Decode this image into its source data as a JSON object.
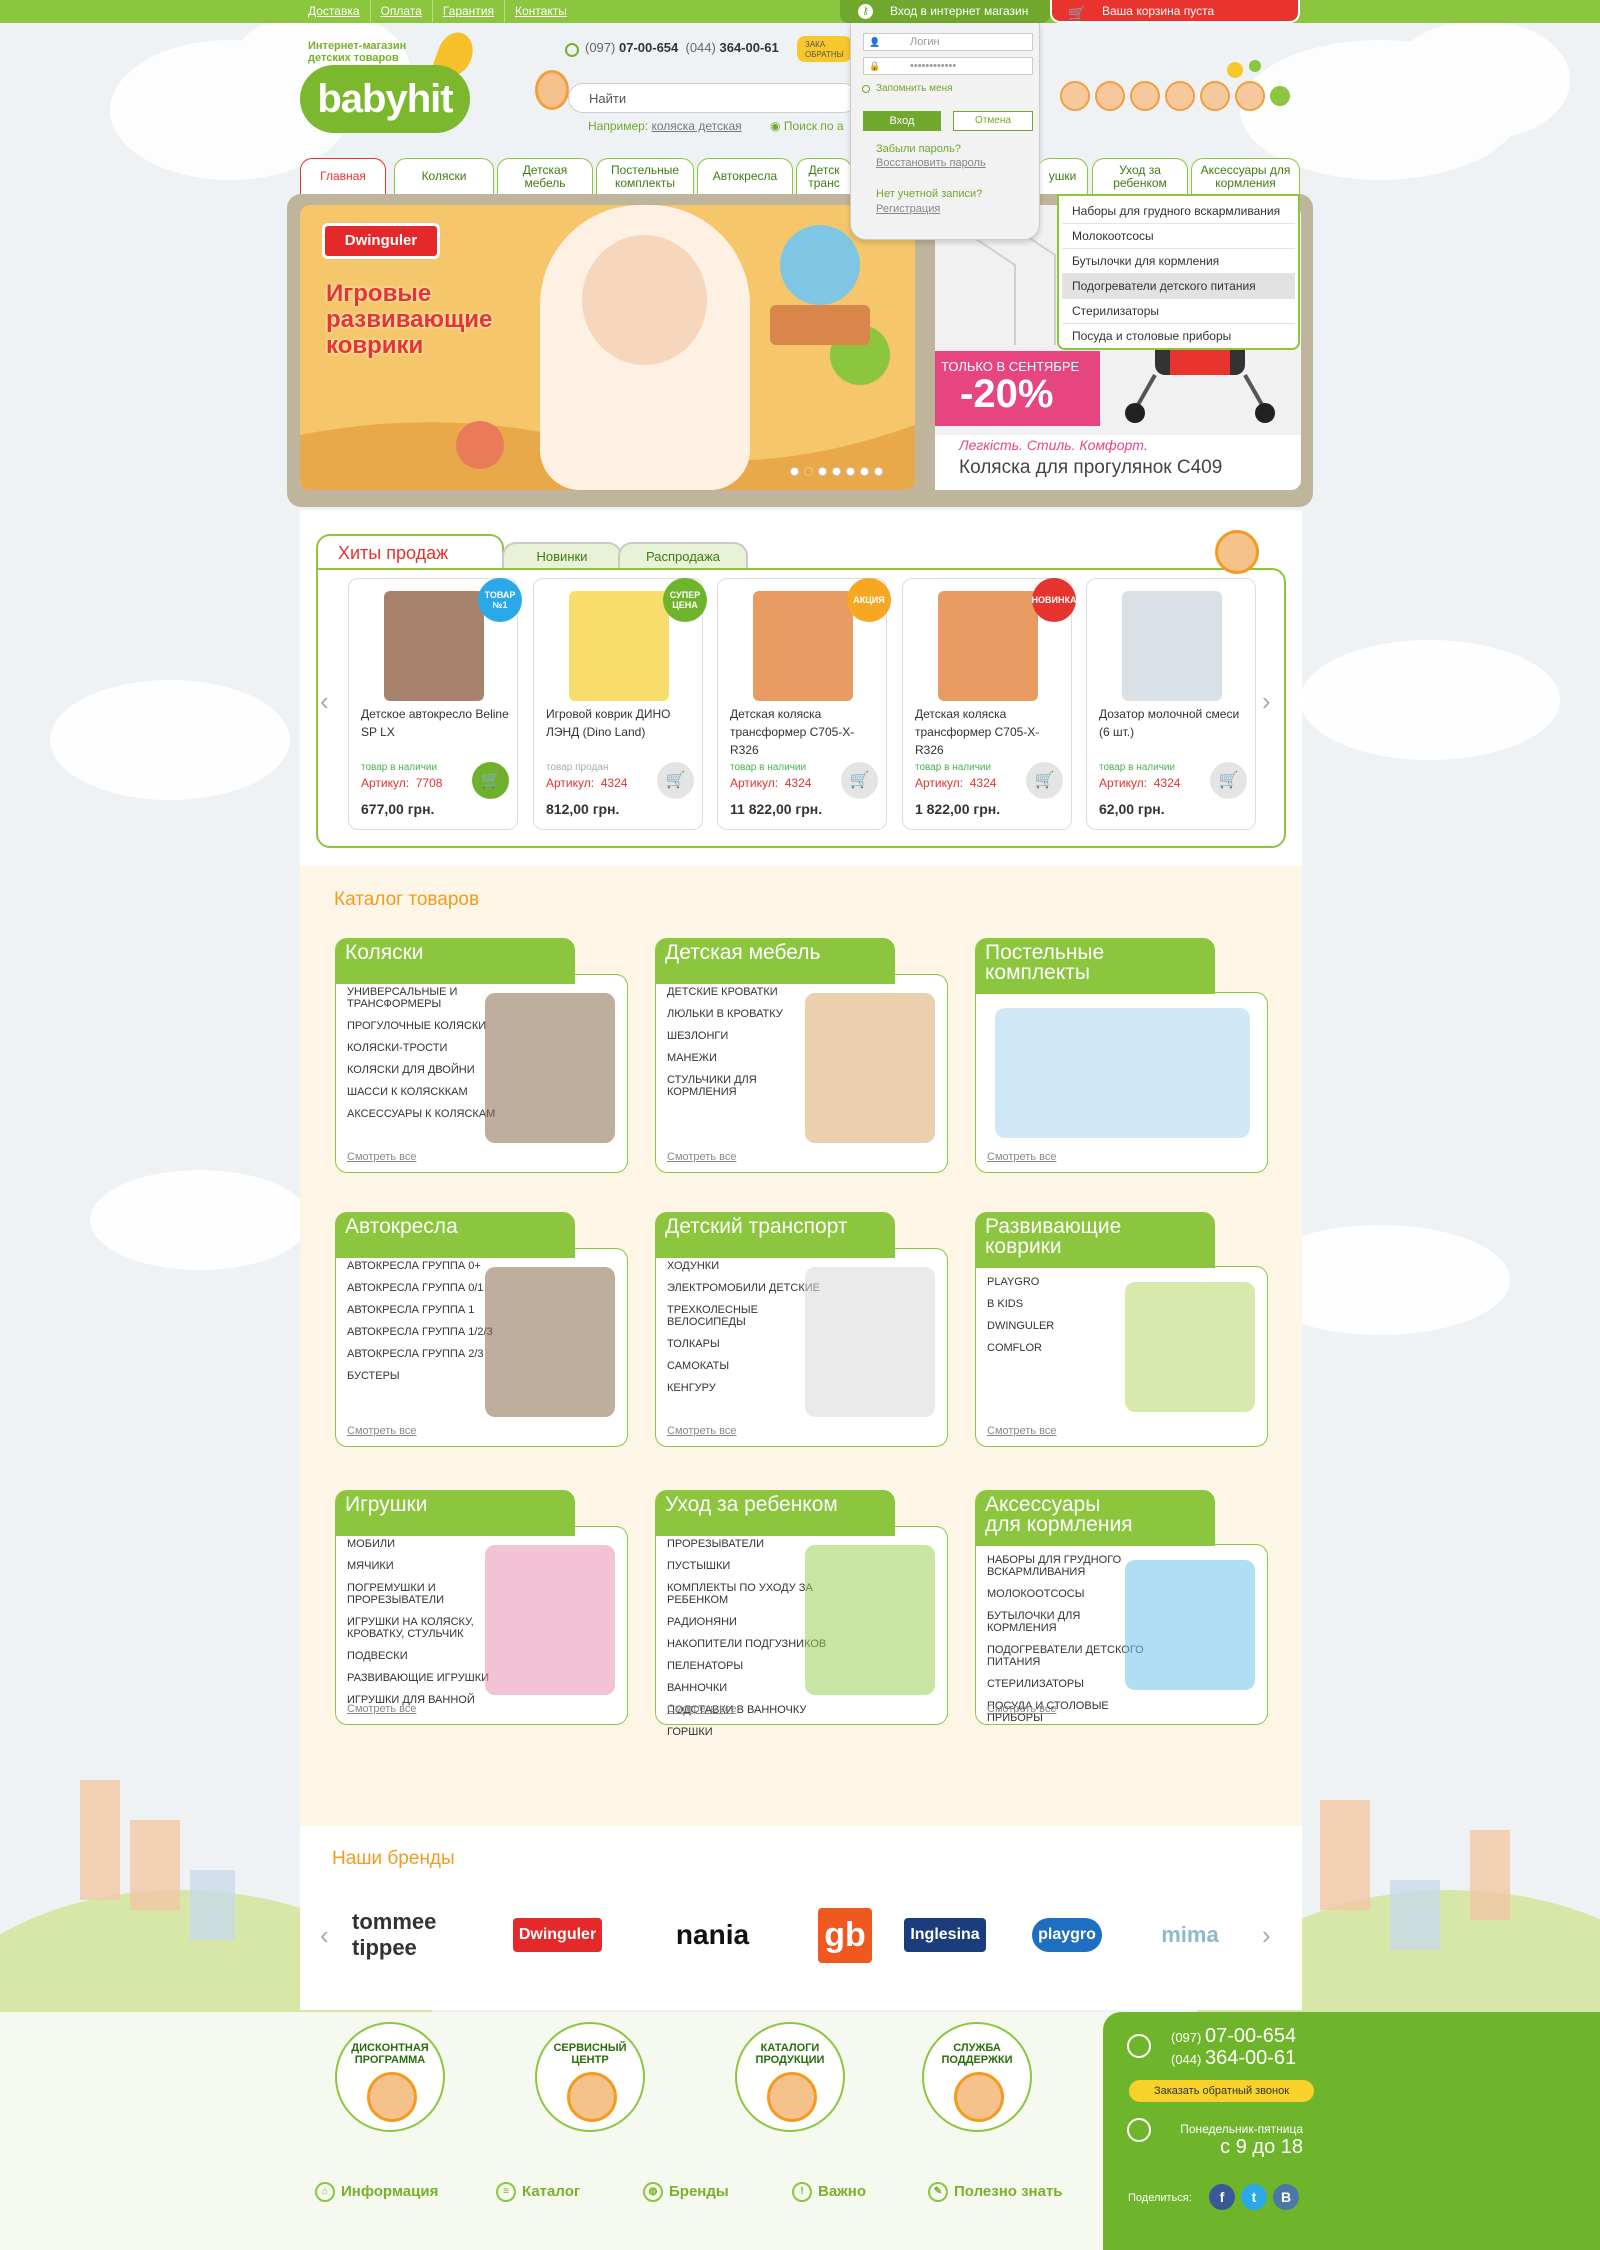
{
  "topbar": {
    "links": [
      "Доставка",
      "Оплата",
      "Гарантия",
      "Контакты"
    ],
    "login_label": "Вход в интернет магазин",
    "cart_label": "Ваша корзина пуста"
  },
  "header": {
    "logo_text": "babyhit",
    "logo_subtitle_line1": "Интернет-магазин",
    "logo_subtitle_line2": "детских товаров",
    "phone1_code": "(097)",
    "phone1_num": "07-00-654",
    "phone2_code": "(044)",
    "phone2_num": "364-00-61",
    "callback_short_line1": "ЗАКА",
    "callback_short_line2": "ОБРАТНЫ",
    "search_placeholder": "Найти",
    "search_example_prefix": "Например:",
    "search_example_link": "коляска детская",
    "search_option": "Поиск по а"
  },
  "login_popup": {
    "login_placeholder": "Логин",
    "password_value": "••••••••••••",
    "remember_label": "Запомнить меня",
    "login_button": "Вход",
    "cancel_button": "Отмена",
    "forgot_label": "Забыли пароль?",
    "restore_link": "Восстановить пароль",
    "no_account_label": "Нет учетной записи?",
    "register_link": "Регистрация"
  },
  "nav": {
    "tabs": [
      "Главная",
      "Коляски",
      "Детская мебель",
      "Постельные комплекты",
      "Автокресла",
      "Детск транс",
      "ушки",
      "Уход за ребенком",
      "Аксессуары для кормления"
    ],
    "active_tab": "Главная"
  },
  "dropdown": {
    "items": [
      "Наборы для грудного вскармливания",
      "Молокоотсосы",
      "Бутылочки для кормления",
      "Подогреватели детского питания",
      "Стерилизаторы",
      "Посуда и столовые приборы"
    ],
    "selected": "Подогреватели детского питания"
  },
  "banner": {
    "brand": "Dwinguler",
    "title_line1": "Игровые",
    "title_line2": "развивающие",
    "title_line3": "коврики",
    "slide_count": 7,
    "active_slide": 1,
    "side_small": "ТОЛЬКО В СЕНТЯБРЕ",
    "side_discount": "-20%",
    "side_slogan": "Легкість. Стиль. Комфорт.",
    "side_product": "Коляска для прогулянок C409"
  },
  "hits": {
    "tabs": [
      "Хиты продаж",
      "Новинки",
      "Распродажа"
    ],
    "products": [
      {
        "name": "Детское автокресло Beline SP LX",
        "badge": "ТОВАР №1",
        "badge_color": "#2aa8e8",
        "availability": "товар в наличии",
        "article_label": "Артикул:",
        "article": "7708",
        "price": "677,00 грн.",
        "cart_active": true
      },
      {
        "name": "Игровой коврик ДИНО ЛЭНД (Dino Land)",
        "badge": "СУПЕР ЦЕНА",
        "badge_color": "#6fb52c",
        "availability": "товар продан",
        "article_label": "Артикул:",
        "article": "4324",
        "price": "812,00 грн.",
        "cart_active": false
      },
      {
        "name": "Детская коляска трансформер C705-X-R326",
        "badge": "АКЦИЯ",
        "badge_color": "#f7a823",
        "availability": "товар в наличии",
        "article_label": "Артикул:",
        "article": "4324",
        "price": "11 822,00 грн.",
        "cart_active": false
      },
      {
        "name": "Детская коляска трансформер C705-X-R326",
        "badge": "НОВИНКА",
        "badge_color": "#e5332f",
        "availability": "товар в наличии",
        "article_label": "Артикул:",
        "article": "4324",
        "price": "1 822,00 грн.",
        "cart_active": false
      },
      {
        "name": "Дозатор молочной смеси (6 шт.)",
        "badge": "",
        "badge_color": "",
        "availability": "товар в наличии",
        "article_label": "Артикул:",
        "article": "4324",
        "price": "62,00 грн.",
        "cart_active": false
      }
    ]
  },
  "catalog": {
    "title": "Каталог товаров",
    "more_label": "Смотреть все",
    "categories": [
      {
        "title_line1": "Коляски",
        "title_line2": "",
        "items": [
          "Универсальные и трансформеры",
          "Прогулочные коляски",
          "Коляски-трости",
          "Коляски для двойни",
          "Шасси к колясккам",
          "Аксессуары к коляскам"
        ]
      },
      {
        "title_line1": "Детская мебель",
        "title_line2": "",
        "items": [
          "Детские кроватки",
          "Люльки в кроватку",
          "Шезлонги",
          "Манежи",
          "Стульчики для кормления"
        ]
      },
      {
        "title_line1": "Постельные",
        "title_line2": "комплекты",
        "items": []
      },
      {
        "title_line1": "Автокресла",
        "title_line2": "",
        "items": [
          "Автокресла группа 0+",
          "Автокресла группа 0/1",
          "Автокресла группа 1",
          "Автокресла группа 1/2/3",
          "Автокресла группа 2/3",
          "Бустеры"
        ]
      },
      {
        "title_line1": "Детский транспорт",
        "title_line2": "",
        "items": [
          "Ходунки",
          "Электромобили детские",
          "Трехколесные велосипеды",
          "Толкары",
          "Самокаты",
          "Кенгуру"
        ]
      },
      {
        "title_line1": "Развивающие",
        "title_line2": "коврики",
        "items": [
          "Playgro",
          "B Kids",
          "Dwinguler",
          "Comflor"
        ]
      },
      {
        "title_line1": "Игрушки",
        "title_line2": "",
        "items": [
          "Мобили",
          "Мячики",
          "Погремушки и прорезыватели",
          "Игрушки на коляску, кроватку, стульчик",
          "Подвески",
          "Развивающие игрушки",
          "Игрушки для ванной"
        ]
      },
      {
        "title_line1": "Уход за ребенком",
        "title_line2": "",
        "items": [
          "Прорезыватели",
          "Пустышки",
          "Комплекты по уходу за ребенком",
          "Радионяни",
          "Накопители подгузников",
          "Пеленаторы",
          "Ванночки",
          "Подставки в ванночку",
          "Горшки"
        ]
      },
      {
        "title_line1": "Аксессуары",
        "title_line2": "для кормления",
        "items": [
          "Наборы для грудного вскармливания",
          "Молокоотсосы",
          "Бутылочки для кормления",
          "Подогреватели детского питания",
          "Стерилизаторы",
          "Посуда и столовые приборы"
        ]
      }
    ]
  },
  "brands": {
    "title": "Наши бренды",
    "items": [
      {
        "name": "tommee tippee",
        "color": "#333333"
      },
      {
        "name": "Dwinguler",
        "color": "#e52829"
      },
      {
        "name": "nania",
        "color": "#111111"
      },
      {
        "name": "gb",
        "color": "#f0581f"
      },
      {
        "name": "Inglesina",
        "color": "#1b3d7d"
      },
      {
        "name": "playgro",
        "color": "#1e6fc0"
      },
      {
        "name": "mima",
        "color": "#8fb8c8"
      }
    ]
  },
  "footer": {
    "circles": [
      {
        "label_line1": "ДИСКОНТНАЯ",
        "label_line2": "ПРОГРАММА"
      },
      {
        "label_line1": "СЕРВИСНЫЙ",
        "label_line2": "ЦЕНТР"
      },
      {
        "label_line1": "КАТАЛОГИ",
        "label_line2": "ПРОДУКЦИИ"
      },
      {
        "label_line1": "СЛУЖБА",
        "label_line2": "ПОДДЕРЖКИ"
      }
    ],
    "links": [
      "Информация",
      "Каталог",
      "Бренды",
      "Важно",
      "Полезно знать"
    ],
    "phone1_code": "(097)",
    "phone1_num": "07-00-654",
    "phone2_code": "(044)",
    "phone2_num": "364-00-61",
    "callback_button": "Заказать обратный звонок",
    "hours_label": "Понедельник-пятница",
    "hours_value": "с 9 до 18",
    "share_label": "Поделиться:",
    "social": [
      "f",
      "t",
      "B"
    ]
  },
  "colors": {
    "accent_green": "#8cc63f",
    "accent_red": "#e5332f",
    "accent_orange": "#f39b1f"
  }
}
